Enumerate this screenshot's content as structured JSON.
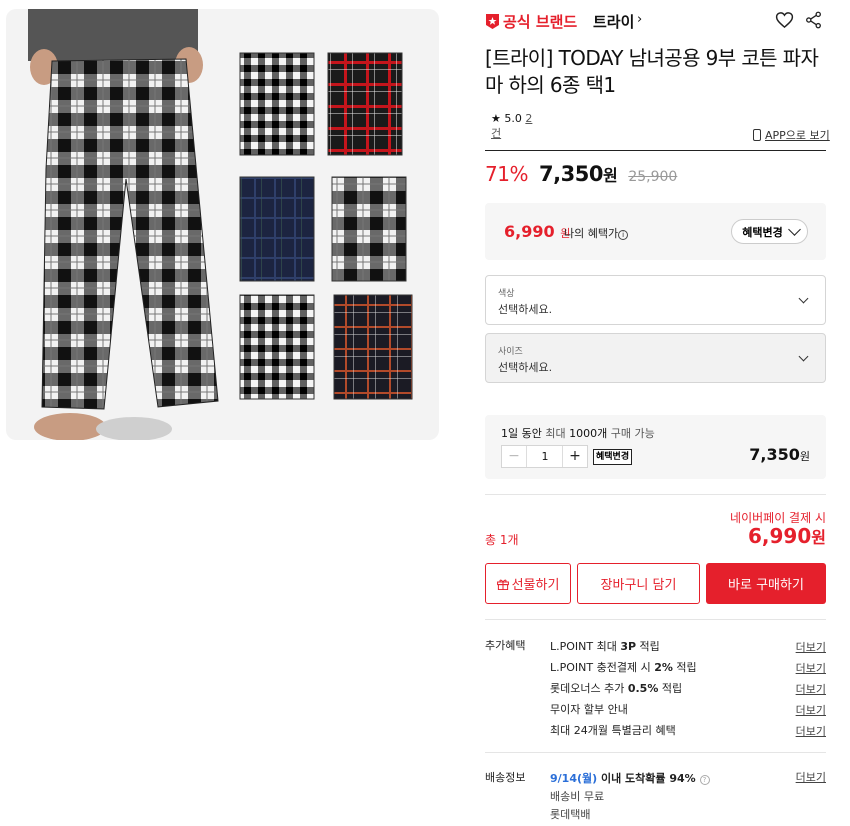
{
  "colors": {
    "accent": "#e5202c",
    "ship_date": "#2b6fd8"
  },
  "brand": {
    "official": "공식 브랜드",
    "name": "트라이",
    "chevron": "›"
  },
  "product": {
    "title": "[트라이] TODAY 남녀공용 9부 코튼 파자마 하의 6종 택1"
  },
  "rating": {
    "star": "★",
    "score": "5.0",
    "count_a": "2",
    "count_b": "건"
  },
  "app_link": "APP으로 보기",
  "price": {
    "discount": "71%",
    "sale": "7,350",
    "won": "원",
    "original": "25,900"
  },
  "benefit": {
    "my_price": "6,990",
    "won": "원",
    "label": "나의 혜택가",
    "info": "i",
    "button": "혜택변경"
  },
  "options": [
    {
      "label": "색상",
      "placeholder": "선택하세요."
    },
    {
      "label": "사이즈",
      "placeholder": "선택하세요."
    }
  ],
  "quantity": {
    "limit_1": "1일 동안",
    "limit_2": "최대",
    "limit_3": "1000개",
    "limit_4": "구매 가능",
    "minus": "−",
    "value": "1",
    "plus": "+",
    "mini_button": "혜택변경",
    "line_price": "7,350",
    "won": "원"
  },
  "summary": {
    "naverpay": "네이버페이 결제 시",
    "total_label": "총 1개",
    "total_price": "6,990",
    "won": "원"
  },
  "actions": {
    "gift": "선물하기",
    "cart": "장바구니 담기",
    "buy": "바로 구매하기"
  },
  "extra": {
    "label": "추가혜택",
    "items": [
      {
        "pre": "L.POINT 최대 ",
        "bold": "3P",
        "post": " 적립"
      },
      {
        "pre": "L.POINT 충전결제 시 ",
        "bold": "2%",
        "post": " 적립"
      },
      {
        "pre": "롯데오너스 추가 ",
        "bold": "0.5%",
        "post": " 적립"
      },
      {
        "pre": "무이자 할부 안내",
        "bold": "",
        "post": ""
      },
      {
        "pre": "최대 24개월 특별금리 혜택",
        "bold": "",
        "post": ""
      }
    ],
    "more": "더보기"
  },
  "shipping": {
    "label": "배송정보",
    "date": "9/14(월)",
    "prob": " 이내 도착확률 94% ",
    "q": "?",
    "fee": "배송비 무료",
    "carrier": "롯데택배",
    "more": "더보기"
  }
}
